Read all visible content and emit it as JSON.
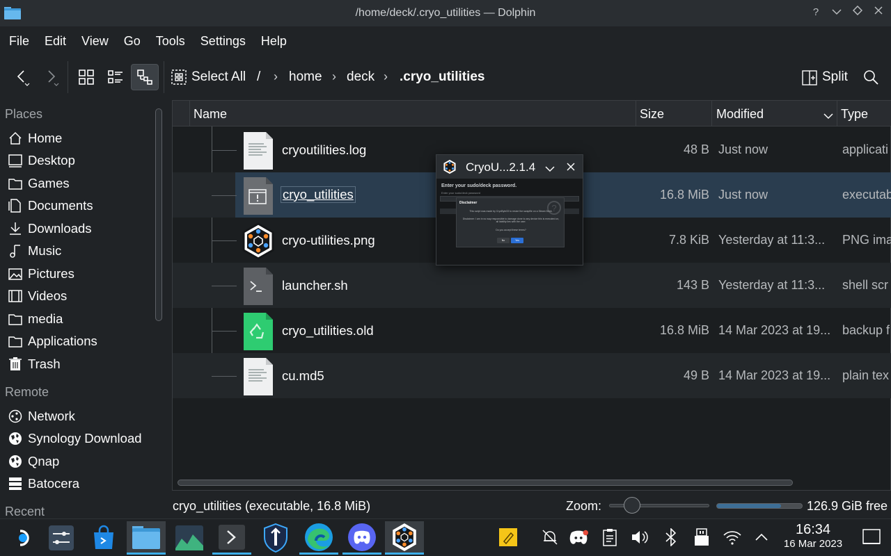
{
  "window": {
    "title": "/home/deck/.cryo_utilities — Dolphin"
  },
  "menubar": [
    "File",
    "Edit",
    "View",
    "Go",
    "Tools",
    "Settings",
    "Help"
  ],
  "toolbar": {
    "select_all": "Select All",
    "split": "Split",
    "breadcrumb": [
      "/",
      "home",
      "deck",
      ".cryo_utilities"
    ]
  },
  "places": {
    "section_places": "Places",
    "items": [
      "Home",
      "Desktop",
      "Games",
      "Documents",
      "Downloads",
      "Music",
      "Pictures",
      "Videos",
      "media",
      "Applications",
      "Trash"
    ],
    "section_remote": "Remote",
    "remote_items": [
      "Network",
      "Synology Download",
      "Qnap",
      "Batocera"
    ],
    "section_recent": "Recent"
  },
  "columns": {
    "name": "Name",
    "size": "Size",
    "modified": "Modified",
    "type": "Type"
  },
  "files": [
    {
      "name": "cryoutilities.log",
      "size": "48 B",
      "modified": "Just now",
      "type": "applicati",
      "icon": "text-file-icon"
    },
    {
      "name": "cryo_utilities",
      "size": "16.8 MiB",
      "modified": "Just now",
      "type": "executab",
      "icon": "executable-icon"
    },
    {
      "name": "cryo-utilities.png",
      "size": "7.8 KiB",
      "modified": "Yesterday at 11:3...",
      "type": "PNG ima",
      "icon": "cryo-logo-icon"
    },
    {
      "name": "launcher.sh",
      "size": "143 B",
      "modified": "Yesterday at 11:3...",
      "type": "shell scr",
      "icon": "shell-script-icon"
    },
    {
      "name": "cryo_utilities.old",
      "size": "16.8 MiB",
      "modified": "14 Mar 2023 at 19...",
      "type": "backup f",
      "icon": "backup-file-icon"
    },
    {
      "name": "cu.md5",
      "size": "49 B",
      "modified": "14 Mar 2023 at 19...",
      "type": "plain tex",
      "icon": "text-file-icon"
    }
  ],
  "status": {
    "text": "cryo_utilities (executable, 16.8 MiB)",
    "zoom_label": "Zoom:",
    "free_space": "126.9 GiB free"
  },
  "popup": {
    "title": "CryoU...2.1.4",
    "heading": "Enter your sudo/deck password.",
    "sub": "Enter your sudo/deck password",
    "dialog_title": "Disclaimer",
    "dialog_line1": "This script was made by CryoByte33 to resize the swapfile on a Steam Deck.",
    "dialog_line2": "Disclaimer: I am in no way responsible to damage done to any device this is executed on, all liability lies with the user.",
    "dialog_line3": "Do you accept these terms?",
    "no": "No",
    "yes": "Yes"
  },
  "clock": {
    "time": "16:34",
    "date": "16 Mar 2023"
  },
  "colors": {
    "accent": "#3daee9",
    "selection": "#2a3d4f"
  }
}
